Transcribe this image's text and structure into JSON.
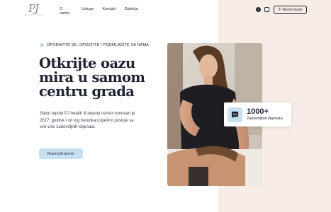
{
  "logo": {
    "mark": "PJ",
    "subtitle": "HEALTH & BEAUTY CENTER"
  },
  "nav": {
    "items": [
      "O nama",
      "Usluge",
      "Kontakt",
      "Galerija"
    ]
  },
  "header": {
    "social_icons": [
      "facebook-icon",
      "instagram-icon"
    ],
    "reserve_label": "Rezervacije",
    "reserve_icon": "phone-icon"
  },
  "hero": {
    "tagline": "OPORAVITE SE, OPUSTITE I PODMLADITE SA NAMA",
    "headline": "Otkrijte oazu mira u samom centru grada",
    "description": "Salon lepote PJ health & beauty center osnovan je 2017. godine i od tog trenutka uspešno posluje sa sve više zadovoljnih klijenata.",
    "cta_label": "Rezerviši termin"
  },
  "stats": {
    "number": "1000+",
    "label": "Zadovoljnih klijenata",
    "icon": "chat-icon"
  },
  "colors": {
    "accent": "#c6e0f1",
    "peach": "#f7ece6",
    "dark": "#1e2431"
  }
}
